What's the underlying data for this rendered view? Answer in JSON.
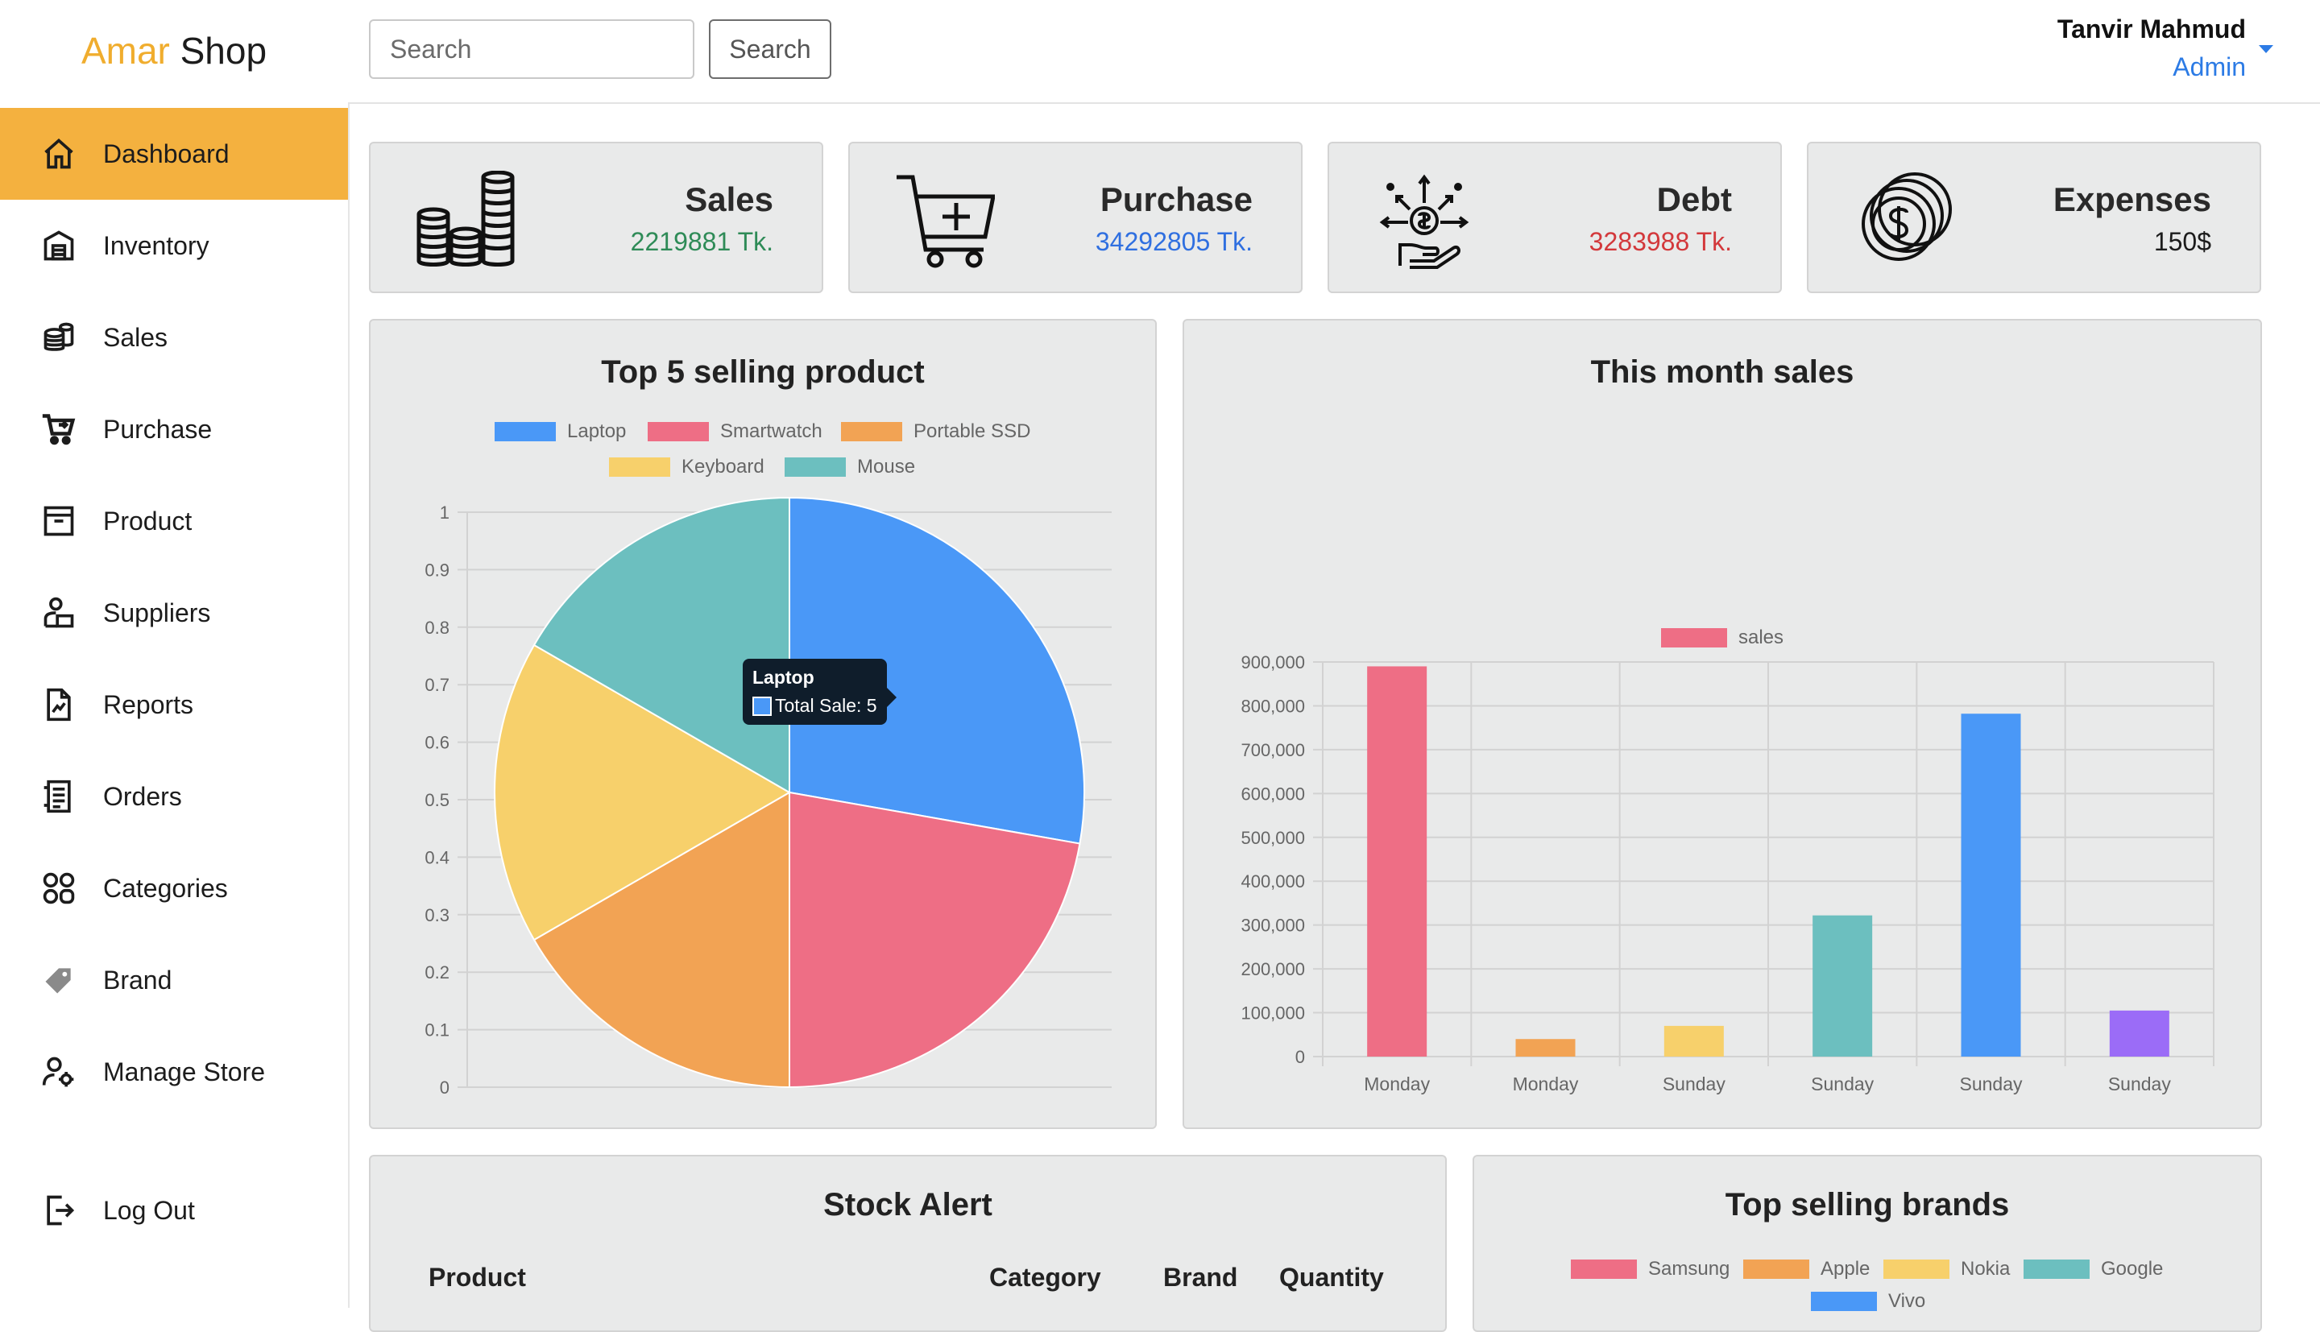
{
  "brand": {
    "part1": "Amar",
    "part2": "Shop"
  },
  "sidebar": {
    "items": [
      {
        "label": "Dashboard",
        "icon": "home-icon"
      },
      {
        "label": "Inventory",
        "icon": "warehouse-icon"
      },
      {
        "label": "Sales",
        "icon": "coins-icon"
      },
      {
        "label": "Purchase",
        "icon": "cart-icon"
      },
      {
        "label": "Product",
        "icon": "archive-box-icon"
      },
      {
        "label": "Suppliers",
        "icon": "supplier-icon"
      },
      {
        "label": "Reports",
        "icon": "report-icon"
      },
      {
        "label": "Orders",
        "icon": "receipt-icon"
      },
      {
        "label": "Categories",
        "icon": "categories-icon"
      },
      {
        "label": "Brand",
        "icon": "tag-icon"
      },
      {
        "label": "Manage Store",
        "icon": "user-gear-icon"
      }
    ],
    "logout": "Log Out"
  },
  "header": {
    "search_placeholder": "Search",
    "search_button": "Search",
    "user_name": "Tanvir Mahmud",
    "user_role": "Admin"
  },
  "stats": [
    {
      "title": "Sales",
      "value": "2219881 Tk.",
      "color": "#2e8b57",
      "icon": "coin-stacks-icon"
    },
    {
      "title": "Purchase",
      "value": "34292805 Tk.",
      "color": "#2f6fe0",
      "icon": "cart-plus-icon"
    },
    {
      "title": "Debt",
      "value": "3283988 Tk.",
      "color": "#d3383b",
      "icon": "money-hand-icon"
    },
    {
      "title": "Expenses",
      "value": "150$",
      "color": "#1c1c1c",
      "icon": "dollar-coins-icon"
    }
  ],
  "pie_panel": {
    "title": "Top 5 selling product"
  },
  "bar_panel": {
    "title": "This month sales"
  },
  "stock_panel": {
    "title": "Stock Alert",
    "columns": [
      "Product",
      "Category",
      "Brand",
      "Quantity"
    ]
  },
  "brands_panel": {
    "title": "Top selling brands",
    "legend": [
      {
        "name": "Samsung",
        "color": "#ee6e85"
      },
      {
        "name": "Apple",
        "color": "#f2a354"
      },
      {
        "name": "Nokia",
        "color": "#f7d06b"
      },
      {
        "name": "Google",
        "color": "#6cbfbf"
      },
      {
        "name": "Vivo",
        "color": "#4a98f7"
      }
    ]
  },
  "tooltip": {
    "title": "Laptop",
    "text": "Total Sale: 5"
  },
  "chart_data": [
    {
      "type": "pie",
      "title": "Top 5 selling product",
      "categories": [
        "Laptop",
        "Smartwatch",
        "Portable SSD",
        "Keyboard",
        "Mouse"
      ],
      "values": [
        5,
        4,
        3,
        3,
        3
      ],
      "colors": [
        "#4a98f7",
        "#ee6e85",
        "#f2a354",
        "#f7d06b",
        "#6cbfbf"
      ],
      "axis_ticks": [
        "1",
        "0.9",
        "0.8",
        "0.7",
        "0.6",
        "0.5",
        "0.4",
        "0.3",
        "0.2",
        "0.1",
        "0"
      ],
      "legend": "top"
    },
    {
      "type": "bar",
      "title": "This month sales",
      "series": [
        {
          "name": "sales",
          "values": [
            890000,
            40000,
            70000,
            322000,
            782000,
            105000
          ]
        }
      ],
      "categories": [
        "Monday",
        "Monday",
        "Sunday",
        "Sunday",
        "Sunday",
        "Sunday"
      ],
      "colors": [
        "#ee6e85",
        "#f2a354",
        "#f7d06b",
        "#6cbfbf",
        "#4a98f7",
        "#9b6cf7"
      ],
      "ylim": [
        0,
        900000
      ],
      "yticks": [
        "900,000",
        "800,000",
        "700,000",
        "600,000",
        "500,000",
        "400,000",
        "300,000",
        "200,000",
        "100,000",
        "0"
      ],
      "grid": true,
      "legend": "top"
    }
  ]
}
